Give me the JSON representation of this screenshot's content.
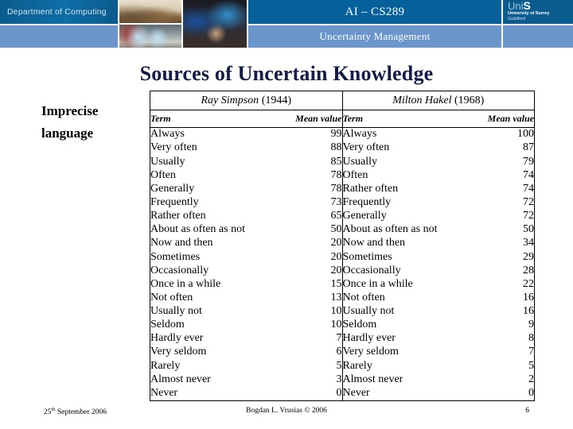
{
  "header": {
    "department": "Department of Computing",
    "course": "AI – CS289",
    "topic": "Uncertainty Management",
    "logo": {
      "uni_prefix": "Uni",
      "uni_suffix": "S",
      "university": "University of Surrey",
      "city": "Guildford"
    },
    "colors": {
      "dark_blue": "#06619b",
      "light_blue": "#6a96cb",
      "left_block": "#0b5c8e"
    }
  },
  "slide": {
    "title": "Sources of Uncertain Knowledge",
    "callout_line1": "Imprecise",
    "callout_line2": "language",
    "title_color": "#141b49"
  },
  "table": {
    "groups": [
      {
        "author": "Ray Simpson",
        "year": "(1944)"
      },
      {
        "author": "Milton Hakel",
        "year": "(1968)"
      }
    ],
    "columns": [
      "Term",
      "Mean value"
    ],
    "rows": [
      {
        "left_term": "Always",
        "left_value": "99",
        "right_term": "Always",
        "right_value": "100"
      },
      {
        "left_term": "Very often",
        "left_value": "88",
        "right_term": "Very often",
        "right_value": "87"
      },
      {
        "left_term": "Usually",
        "left_value": "85",
        "right_term": "Usually",
        "right_value": "79"
      },
      {
        "left_term": "Often",
        "left_value": "78",
        "right_term": "Often",
        "right_value": "74"
      },
      {
        "left_term": "Generally",
        "left_value": "78",
        "right_term": "Rather often",
        "right_value": "74"
      },
      {
        "left_term": "Frequently",
        "left_value": "73",
        "right_term": "Frequently",
        "right_value": "72"
      },
      {
        "left_term": "Rather often",
        "left_value": "65",
        "right_term": "Generally",
        "right_value": "72"
      },
      {
        "left_term": "About as often as not",
        "left_value": "50",
        "right_term": "About as often as not",
        "right_value": "50"
      },
      {
        "left_term": "Now and then",
        "left_value": "20",
        "right_term": "Now and then",
        "right_value": "34"
      },
      {
        "left_term": "Sometimes",
        "left_value": "20",
        "right_term": "Sometimes",
        "right_value": "29"
      },
      {
        "left_term": "Occasionally",
        "left_value": "20",
        "right_term": "Occasionally",
        "right_value": "28"
      },
      {
        "left_term": "Once in a while",
        "left_value": "15",
        "right_term": "Once in a while",
        "right_value": "22"
      },
      {
        "left_term": "Not often",
        "left_value": "13",
        "right_term": "Not often",
        "right_value": "16"
      },
      {
        "left_term": "Usually not",
        "left_value": "10",
        "right_term": "Usually not",
        "right_value": "16"
      },
      {
        "left_term": "Seldom",
        "left_value": "10",
        "right_term": "Seldom",
        "right_value": "9"
      },
      {
        "left_term": "Hardly ever",
        "left_value": "7",
        "right_term": "Hardly ever",
        "right_value": "8"
      },
      {
        "left_term": "Very seldom",
        "left_value": "6",
        "right_term": "Very seldom",
        "right_value": "7"
      },
      {
        "left_term": "Rarely",
        "left_value": "5",
        "right_term": "Rarely",
        "right_value": "5"
      },
      {
        "left_term": "Almost never",
        "left_value": "3",
        "right_term": "Almost never",
        "right_value": "2"
      },
      {
        "left_term": "Never",
        "left_value": "0",
        "right_term": "Never",
        "right_value": "0"
      }
    ]
  },
  "footer": {
    "date_number": "25",
    "date_ordinal": "th",
    "date_rest": " September 2006",
    "author": "Bogdan L. Vrusias © 2006",
    "page": "6"
  }
}
